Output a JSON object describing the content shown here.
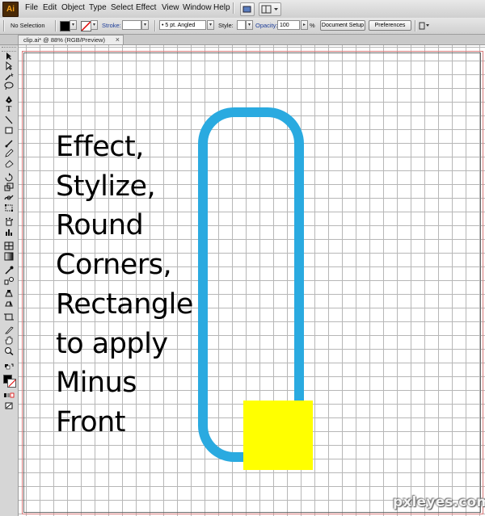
{
  "app": {
    "logo_text": "Ai",
    "menus": [
      "File",
      "Edit",
      "Object",
      "Type",
      "Select",
      "Effect",
      "View",
      "Window",
      "Help"
    ]
  },
  "control_bar": {
    "selection": "No Selection",
    "stroke_label": "Stroke:",
    "brush": "5 pt. Angled",
    "style_label": "Style:",
    "opacity_label": "Opacity:",
    "opacity_value": "100",
    "percent": "%",
    "document_setup": "Document Setup",
    "preferences": "Preferences"
  },
  "document": {
    "tab_label": "clip.ai* @ 88% (RGB/Preview)",
    "close_glyph": "×"
  },
  "artwork": {
    "text_lines": [
      "Effect,",
      "Stylize,",
      "Round",
      "Corners,",
      "Rectangle",
      "to apply",
      "Minus",
      "Front"
    ],
    "rounded_rect_stroke": "#2aaae0",
    "square_fill": "#ffff00"
  },
  "watermark": "pxleyes.com",
  "icons": {
    "tools": [
      "selection-icon",
      "direct-selection-icon",
      "magic-wand-icon",
      "lasso-icon",
      "pen-icon",
      "type-icon",
      "line-icon",
      "rectangle-icon",
      "paintbrush-icon",
      "pencil-icon",
      "eraser-icon",
      "rotate-icon",
      "scale-icon",
      "warp-icon",
      "free-transform-icon",
      "symbol-sprayer-icon",
      "graph-icon",
      "mesh-icon",
      "gradient-icon",
      "eyedropper-icon",
      "blend-icon",
      "live-paint-icon",
      "live-paint-selection-icon",
      "crop-icon",
      "slice-icon",
      "hand-icon",
      "zoom-icon"
    ]
  }
}
